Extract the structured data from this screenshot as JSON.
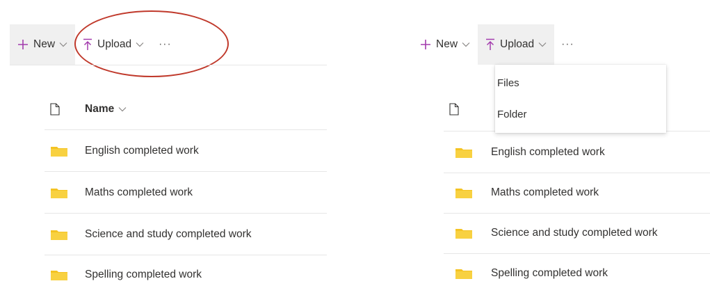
{
  "left_panel": {
    "toolbar": {
      "new_label": "New",
      "upload_label": "Upload",
      "more_label": "···"
    },
    "list": {
      "header_name": "Name",
      "items": [
        {
          "label": "English completed work"
        },
        {
          "label": "Maths completed work"
        },
        {
          "label": "Science and study completed work"
        },
        {
          "label": "Spelling completed work"
        }
      ]
    }
  },
  "right_panel": {
    "toolbar": {
      "new_label": "New",
      "upload_label": "Upload",
      "more_label": "···"
    },
    "upload_menu": {
      "items": [
        {
          "label": "Files"
        },
        {
          "label": "Folder"
        }
      ]
    },
    "list": {
      "items": [
        {
          "label": "English completed work"
        },
        {
          "label": "Maths completed work"
        },
        {
          "label": "Science and study completed work"
        },
        {
          "label": "Spelling completed work"
        }
      ]
    }
  },
  "colors": {
    "accent_purple": "#a33cad",
    "folder_yellow": "#f4c323",
    "annotation_red": "#c0392b",
    "toolbar_shade": "#f0f0f0"
  },
  "icons": {
    "new": "plus-icon",
    "upload": "upload-arrow-icon",
    "chevron": "chevron-down-icon",
    "file": "document-icon",
    "folder": "folder-icon"
  }
}
